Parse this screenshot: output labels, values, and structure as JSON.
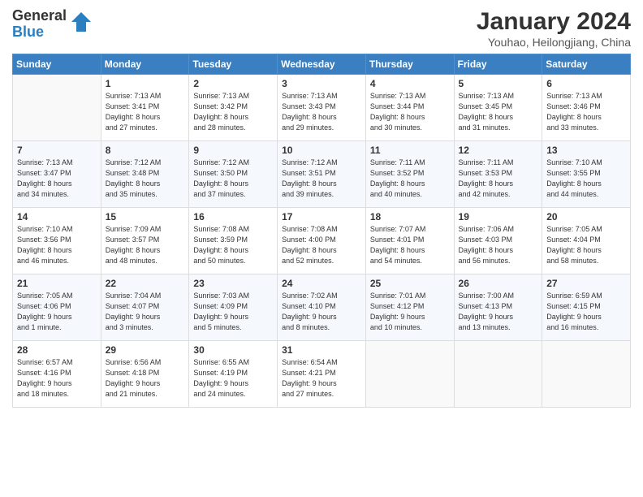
{
  "logo": {
    "general": "General",
    "blue": "Blue"
  },
  "header": {
    "month": "January 2024",
    "location": "Youhao, Heilongjiang, China"
  },
  "days": [
    "Sunday",
    "Monday",
    "Tuesday",
    "Wednesday",
    "Thursday",
    "Friday",
    "Saturday"
  ],
  "weeks": [
    [
      {
        "day": "",
        "content": ""
      },
      {
        "day": "1",
        "content": "Sunrise: 7:13 AM\nSunset: 3:41 PM\nDaylight: 8 hours\nand 27 minutes."
      },
      {
        "day": "2",
        "content": "Sunrise: 7:13 AM\nSunset: 3:42 PM\nDaylight: 8 hours\nand 28 minutes."
      },
      {
        "day": "3",
        "content": "Sunrise: 7:13 AM\nSunset: 3:43 PM\nDaylight: 8 hours\nand 29 minutes."
      },
      {
        "day": "4",
        "content": "Sunrise: 7:13 AM\nSunset: 3:44 PM\nDaylight: 8 hours\nand 30 minutes."
      },
      {
        "day": "5",
        "content": "Sunrise: 7:13 AM\nSunset: 3:45 PM\nDaylight: 8 hours\nand 31 minutes."
      },
      {
        "day": "6",
        "content": "Sunrise: 7:13 AM\nSunset: 3:46 PM\nDaylight: 8 hours\nand 33 minutes."
      }
    ],
    [
      {
        "day": "7",
        "content": "Sunrise: 7:13 AM\nSunset: 3:47 PM\nDaylight: 8 hours\nand 34 minutes."
      },
      {
        "day": "8",
        "content": "Sunrise: 7:12 AM\nSunset: 3:48 PM\nDaylight: 8 hours\nand 35 minutes."
      },
      {
        "day": "9",
        "content": "Sunrise: 7:12 AM\nSunset: 3:50 PM\nDaylight: 8 hours\nand 37 minutes."
      },
      {
        "day": "10",
        "content": "Sunrise: 7:12 AM\nSunset: 3:51 PM\nDaylight: 8 hours\nand 39 minutes."
      },
      {
        "day": "11",
        "content": "Sunrise: 7:11 AM\nSunset: 3:52 PM\nDaylight: 8 hours\nand 40 minutes."
      },
      {
        "day": "12",
        "content": "Sunrise: 7:11 AM\nSunset: 3:53 PM\nDaylight: 8 hours\nand 42 minutes."
      },
      {
        "day": "13",
        "content": "Sunrise: 7:10 AM\nSunset: 3:55 PM\nDaylight: 8 hours\nand 44 minutes."
      }
    ],
    [
      {
        "day": "14",
        "content": "Sunrise: 7:10 AM\nSunset: 3:56 PM\nDaylight: 8 hours\nand 46 minutes."
      },
      {
        "day": "15",
        "content": "Sunrise: 7:09 AM\nSunset: 3:57 PM\nDaylight: 8 hours\nand 48 minutes."
      },
      {
        "day": "16",
        "content": "Sunrise: 7:08 AM\nSunset: 3:59 PM\nDaylight: 8 hours\nand 50 minutes."
      },
      {
        "day": "17",
        "content": "Sunrise: 7:08 AM\nSunset: 4:00 PM\nDaylight: 8 hours\nand 52 minutes."
      },
      {
        "day": "18",
        "content": "Sunrise: 7:07 AM\nSunset: 4:01 PM\nDaylight: 8 hours\nand 54 minutes."
      },
      {
        "day": "19",
        "content": "Sunrise: 7:06 AM\nSunset: 4:03 PM\nDaylight: 8 hours\nand 56 minutes."
      },
      {
        "day": "20",
        "content": "Sunrise: 7:05 AM\nSunset: 4:04 PM\nDaylight: 8 hours\nand 58 minutes."
      }
    ],
    [
      {
        "day": "21",
        "content": "Sunrise: 7:05 AM\nSunset: 4:06 PM\nDaylight: 9 hours\nand 1 minute."
      },
      {
        "day": "22",
        "content": "Sunrise: 7:04 AM\nSunset: 4:07 PM\nDaylight: 9 hours\nand 3 minutes."
      },
      {
        "day": "23",
        "content": "Sunrise: 7:03 AM\nSunset: 4:09 PM\nDaylight: 9 hours\nand 5 minutes."
      },
      {
        "day": "24",
        "content": "Sunrise: 7:02 AM\nSunset: 4:10 PM\nDaylight: 9 hours\nand 8 minutes."
      },
      {
        "day": "25",
        "content": "Sunrise: 7:01 AM\nSunset: 4:12 PM\nDaylight: 9 hours\nand 10 minutes."
      },
      {
        "day": "26",
        "content": "Sunrise: 7:00 AM\nSunset: 4:13 PM\nDaylight: 9 hours\nand 13 minutes."
      },
      {
        "day": "27",
        "content": "Sunrise: 6:59 AM\nSunset: 4:15 PM\nDaylight: 9 hours\nand 16 minutes."
      }
    ],
    [
      {
        "day": "28",
        "content": "Sunrise: 6:57 AM\nSunset: 4:16 PM\nDaylight: 9 hours\nand 18 minutes."
      },
      {
        "day": "29",
        "content": "Sunrise: 6:56 AM\nSunset: 4:18 PM\nDaylight: 9 hours\nand 21 minutes."
      },
      {
        "day": "30",
        "content": "Sunrise: 6:55 AM\nSunset: 4:19 PM\nDaylight: 9 hours\nand 24 minutes."
      },
      {
        "day": "31",
        "content": "Sunrise: 6:54 AM\nSunset: 4:21 PM\nDaylight: 9 hours\nand 27 minutes."
      },
      {
        "day": "",
        "content": ""
      },
      {
        "day": "",
        "content": ""
      },
      {
        "day": "",
        "content": ""
      }
    ]
  ]
}
